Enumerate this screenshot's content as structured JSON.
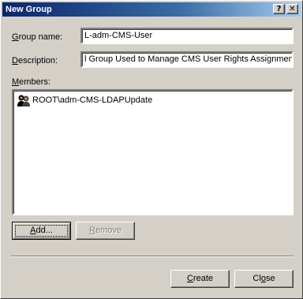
{
  "window": {
    "title": "New Group",
    "help_label": "?",
    "close_label": "✕"
  },
  "form": {
    "group_name_label_accel": "G",
    "group_name_label_rest": "roup name:",
    "group_name_value": "L-adm-CMS-User",
    "description_label_accel": "D",
    "description_label_rest": "escription:",
    "description_value": "l Group Used to Manage CMS User Rights Assignments",
    "members_label_accel": "M",
    "members_label_rest": "embers:"
  },
  "members": [
    {
      "name": "ROOT\\adm-CMS-LDAPUpdate",
      "icon": "group-icon"
    }
  ],
  "buttons": {
    "add_accel": "A",
    "add_rest": "dd...",
    "remove_accel": "R",
    "remove_rest": "emove",
    "create_accel": "C",
    "create_rest": "reate",
    "close_accel": "",
    "close_rest": "Cl",
    "close_accel2": "o",
    "close_rest2": "se"
  }
}
